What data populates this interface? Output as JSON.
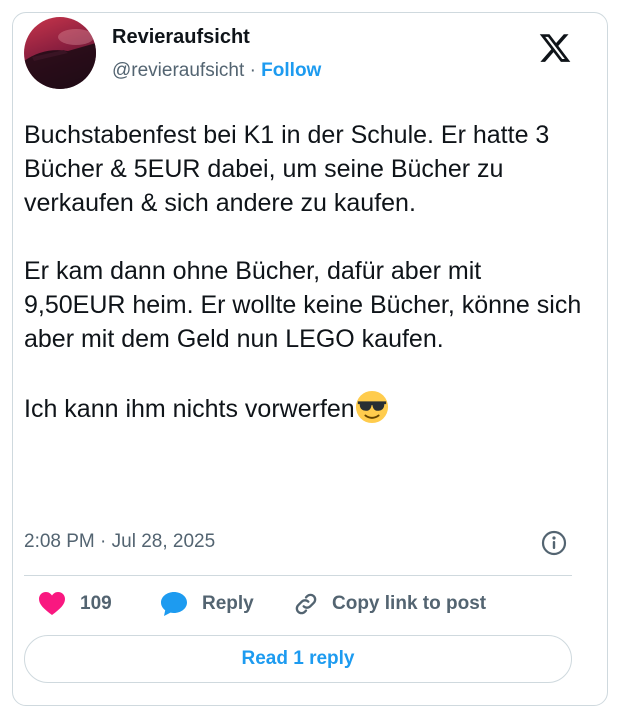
{
  "author": {
    "display_name": "Revieraufsicht",
    "handle": "@revieraufsicht",
    "separator": "·",
    "follow_label": "Follow"
  },
  "tweet": {
    "text": "Buchstabenfest bei K1 in der Schule. Er hatte 3 Bücher & 5EUR dabei, um seine Bücher zu verkaufen & sich andere zu kaufen.\n\nEr kam dann ohne Bücher, dafür aber mit 9,50EUR heim. Er wollte keine Bücher, könne sich aber mit dem Geld nun LEGO kaufen.\n\nIch kann ihm nichts vorwerfen",
    "emoji": "smiling-face-with-sunglasses",
    "timestamp": "2:08 PM · Jul 28, 2025"
  },
  "actions": {
    "like_count": "109",
    "reply_label": "Reply",
    "copy_label": "Copy link to post"
  },
  "read_replies_label": "Read 1 reply",
  "colors": {
    "accent": "#1d9bf0",
    "like": "#f91880",
    "text": "#0f1419",
    "muted": "#536471",
    "border": "#cfd9de"
  }
}
